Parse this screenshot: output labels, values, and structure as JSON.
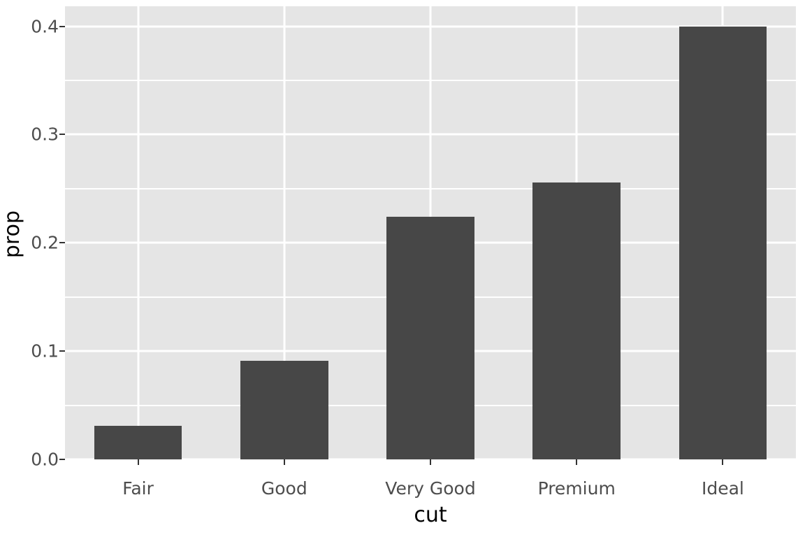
{
  "chart_data": {
    "type": "bar",
    "title": "",
    "subtitle": "",
    "xlabel": "cut",
    "ylabel": "prop",
    "categories": [
      "Fair",
      "Good",
      "Very Good",
      "Premium",
      "Ideal"
    ],
    "values": [
      0.031,
      0.091,
      0.224,
      0.2557,
      0.3995
    ],
    "series": [
      {
        "name": "prop",
        "values": [
          0.031,
          0.091,
          0.224,
          0.2557,
          0.3995
        ]
      }
    ],
    "ylim": [
      0.0,
      0.4185
    ],
    "y_ticks": [
      0.0,
      0.1,
      0.2,
      0.3,
      0.4
    ],
    "y_tick_labels": [
      "0.0",
      "0.1",
      "0.2",
      "0.3",
      "0.4"
    ],
    "y_minor_ticks": [
      0.05,
      0.15,
      0.25,
      0.35
    ],
    "x_tick_labels": [
      "Fair",
      "Good",
      "Very Good",
      "Premium",
      "Ideal"
    ],
    "grid": true,
    "legend": "none",
    "legend_position": "none",
    "bar_color": "#474747",
    "panel_background": "#e5e5e5",
    "gridline_color": "#ffffff",
    "plot_background": "#ffffff",
    "axis_text_color": "#4d4d4d",
    "axis_title_color": "#000000"
  }
}
